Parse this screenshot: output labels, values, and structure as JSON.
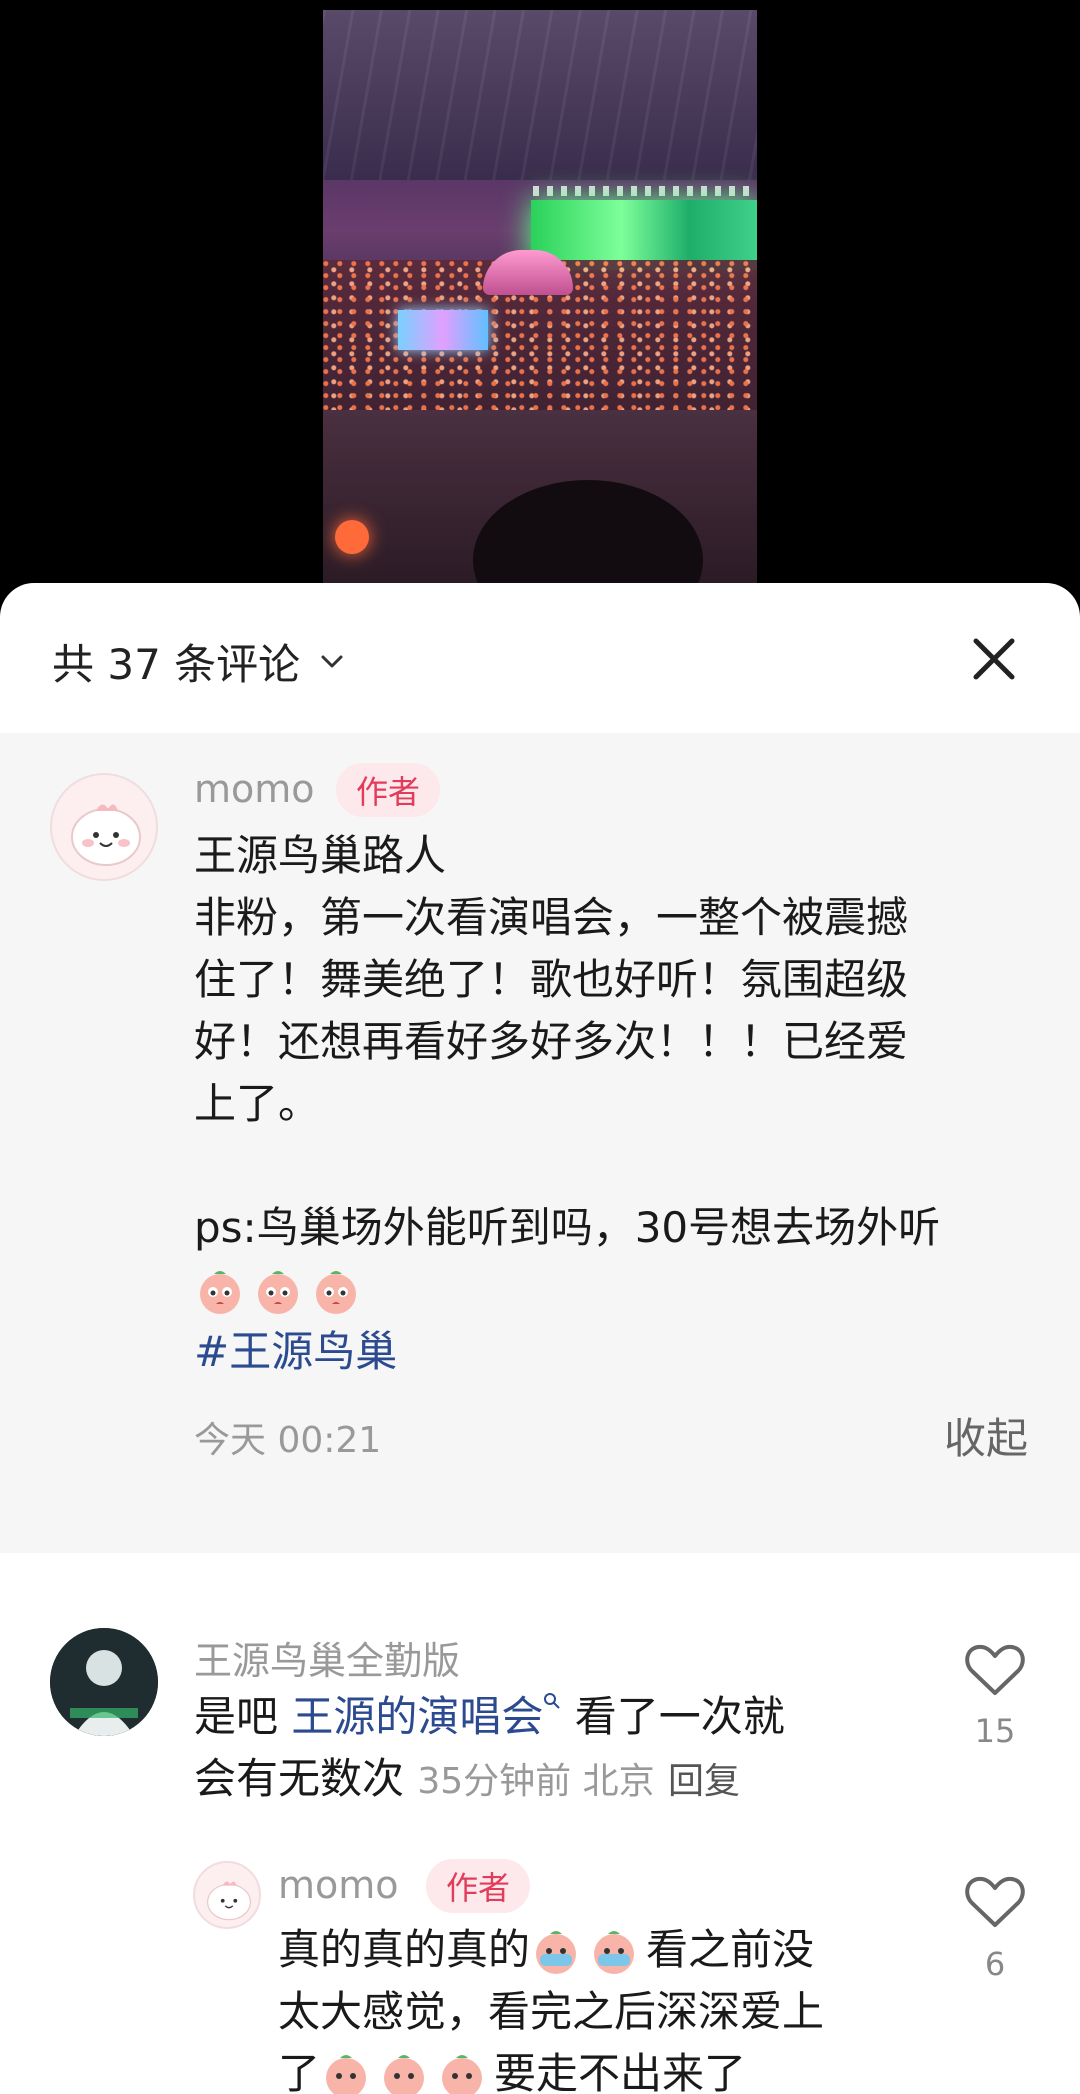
{
  "header": {
    "title": "共 37 条评论"
  },
  "author_comment": {
    "username": "momo",
    "tag": "作者",
    "title_line": "王源鸟巢路人",
    "body_lines": [
      "非粉，第一次看演唱会，一整个被震撼",
      "住了！舞美绝了！歌也好听！氛围超级",
      "好！还想再看好多好多次！！！已经爱",
      "上了。"
    ],
    "ps_line": "ps:鸟巢场外能听到吗，30号想去场外听",
    "hashtag": "#王源鸟巢",
    "time": "今天 00:21",
    "collapse_label": "收起"
  },
  "comment1": {
    "username": "王源鸟巢全勤版",
    "text_prefix": "是吧 ",
    "link": "王源的演唱会",
    "text_suffix": " 看了一次就",
    "line2": "会有无数次 ",
    "meta": "35分钟前 北京",
    "reply": "回复",
    "likes": "15"
  },
  "reply1": {
    "username": "momo",
    "tag": "作者",
    "line1_a": "真的真的真的",
    "line1_b": "看之前没",
    "line2": "太大感觉，看完之后深深爱上",
    "line3_a": "了",
    "line3_b": "要走不出来了",
    "likes": "6"
  },
  "icons": {
    "chevron": "chevron-down-icon",
    "close": "close-icon",
    "like": "heart-outline-icon",
    "emoji": "peach-crying-emoji"
  },
  "colors": {
    "author_tag": "#e33b5a",
    "hashtag": "#2b4a8f"
  }
}
